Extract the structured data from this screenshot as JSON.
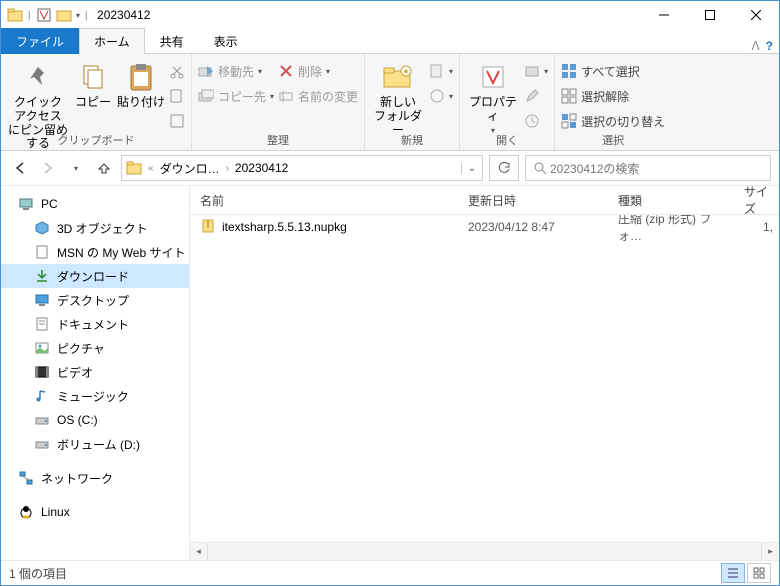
{
  "window": {
    "title": "20230412"
  },
  "tabs": {
    "file": "ファイル",
    "home": "ホーム",
    "share": "共有",
    "view": "表示"
  },
  "ribbon": {
    "clipboard": {
      "label": "クリップボード",
      "pin": "クイック アクセス\nにピン留めする",
      "copy": "コピー",
      "paste": "貼り付け"
    },
    "organize": {
      "label": "整理",
      "move_to": "移動先",
      "copy_to": "コピー先",
      "delete": "削除",
      "rename": "名前の変更"
    },
    "new": {
      "label": "新規",
      "new_folder": "新しい\nフォルダー"
    },
    "open": {
      "label": "開く",
      "properties": "プロパティ"
    },
    "select": {
      "label": "選択",
      "select_all": "すべて選択",
      "deselect": "選択解除",
      "invert": "選択の切り替え"
    }
  },
  "nav": {
    "crumb1": "ダウンロ…",
    "crumb2": "20230412",
    "search_placeholder": "20230412の検索"
  },
  "tree": {
    "pc": "PC",
    "items": [
      "3D オブジェクト",
      "MSN の My Web サイト",
      "ダウンロード",
      "デスクトップ",
      "ドキュメント",
      "ピクチャ",
      "ビデオ",
      "ミュージック",
      "OS (C:)",
      "ボリューム (D:)"
    ],
    "network": "ネットワーク",
    "linux": "Linux"
  },
  "columns": {
    "name": "名前",
    "date": "更新日時",
    "type": "種類",
    "size": "サイズ"
  },
  "rows": [
    {
      "name": "itextsharp.5.5.13.nupkg",
      "date": "2023/04/12 8:47",
      "type": "圧縮 (zip 形式) フォ…",
      "size": "1,"
    }
  ],
  "status": {
    "count": "1 個の項目"
  }
}
